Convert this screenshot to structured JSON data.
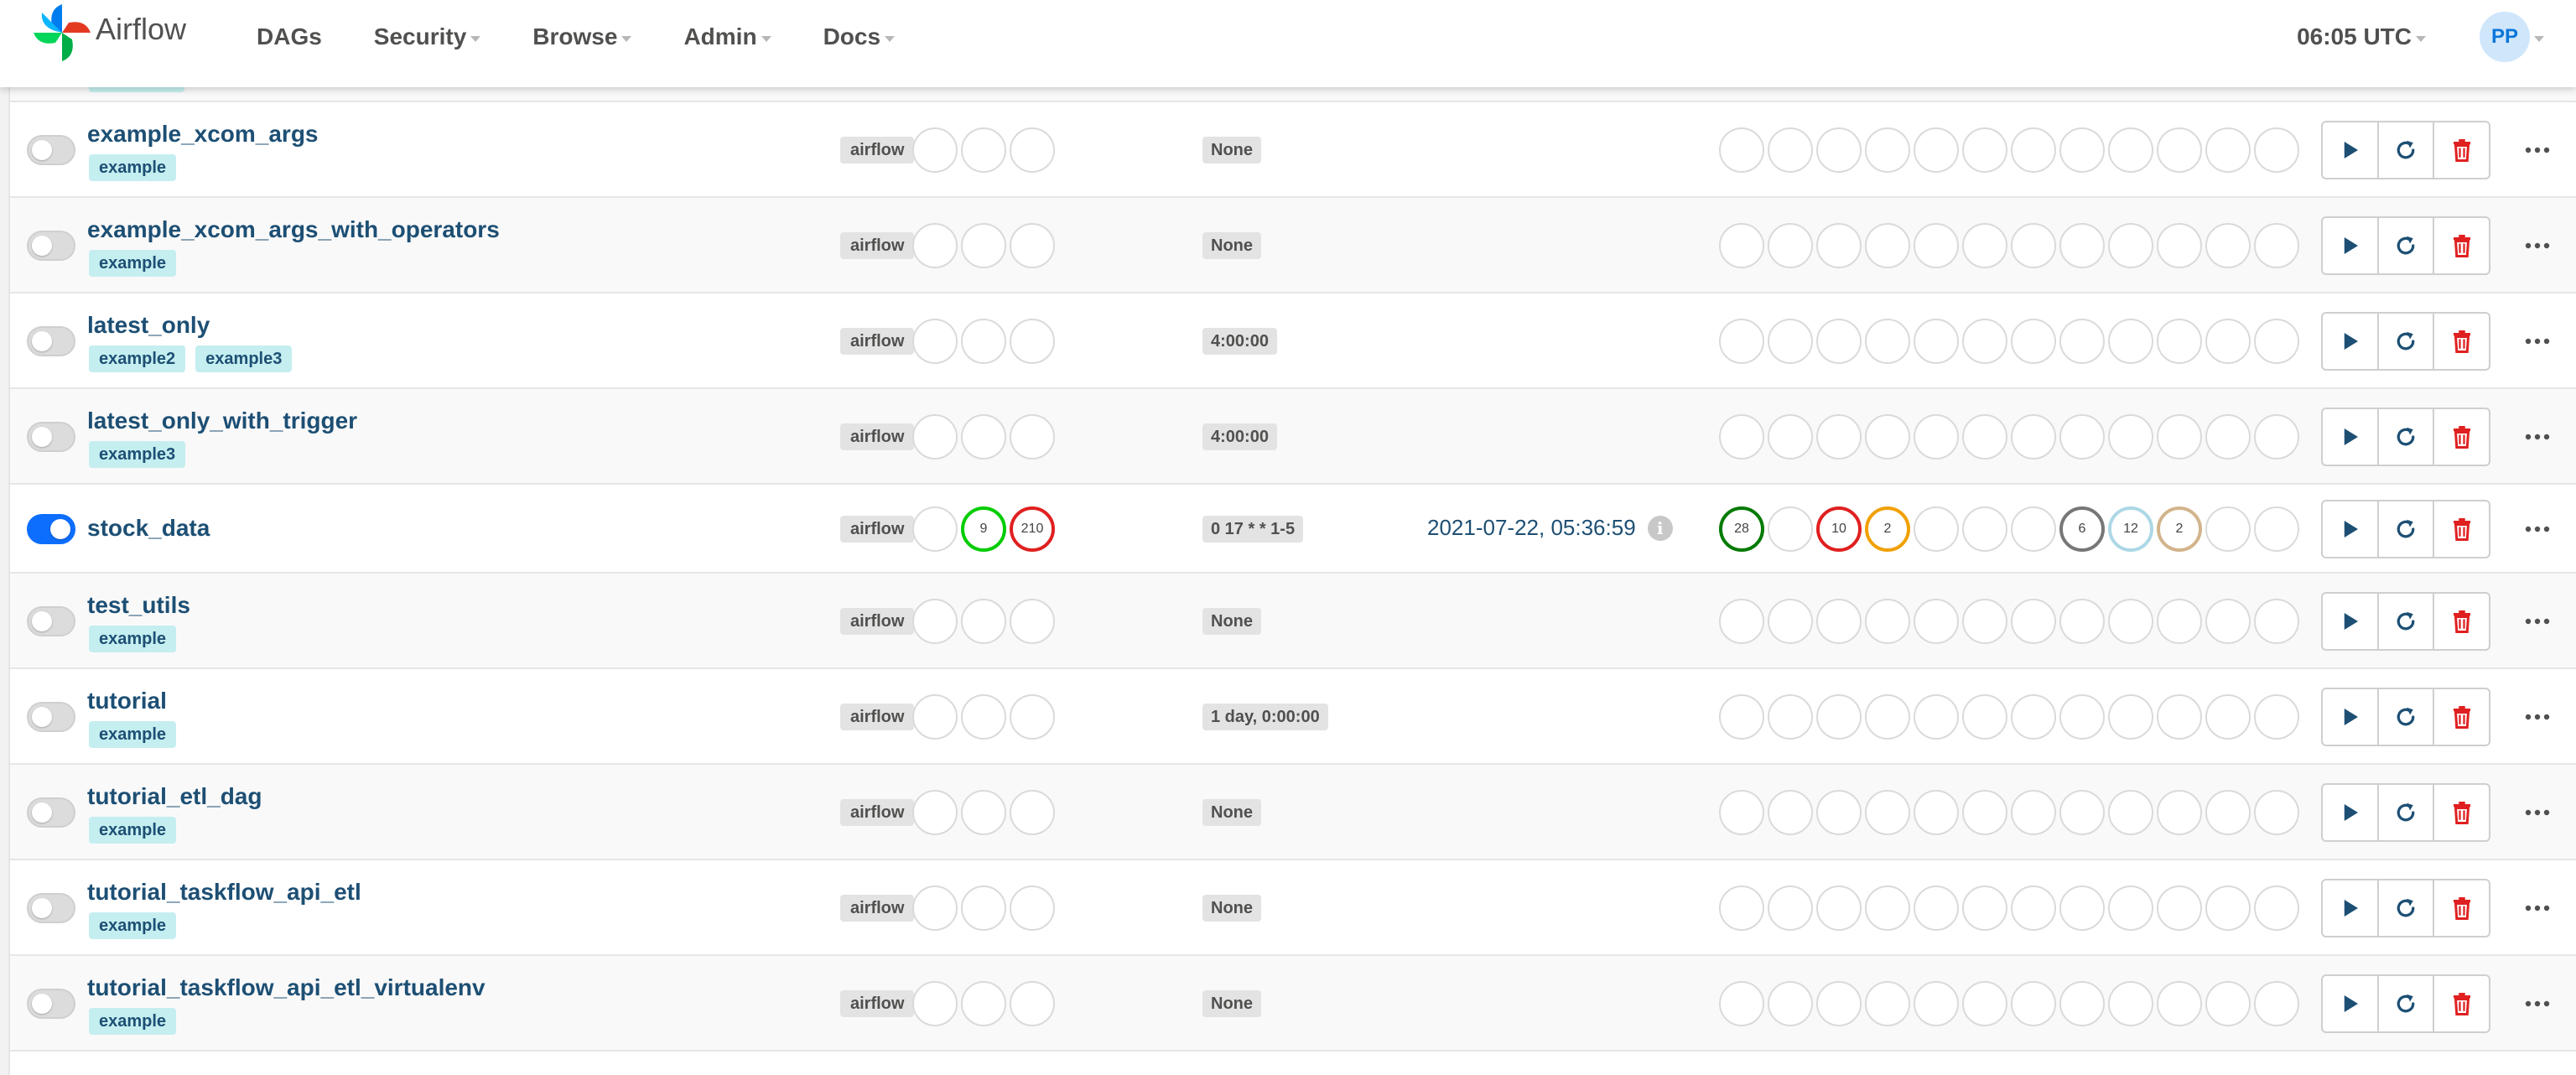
{
  "navbar": {
    "brand": "Airflow",
    "menu": [
      {
        "label": "DAGs",
        "caret": false
      },
      {
        "label": "Security",
        "caret": true
      },
      {
        "label": "Browse",
        "caret": true
      },
      {
        "label": "Admin",
        "caret": true
      },
      {
        "label": "Docs",
        "caret": true
      }
    ],
    "clock": "06:05 UTC",
    "user_initials": "PP"
  },
  "dags": [
    {
      "name": "example_xcom_args",
      "tags": [
        "example"
      ],
      "owner": "airflow",
      "active": false,
      "schedule": "None",
      "last_run": "",
      "runs": [
        "",
        "",
        ""
      ],
      "runs_colors": [
        "",
        "",
        ""
      ],
      "tasks": [
        "",
        "",
        "",
        "",
        "",
        "",
        "",
        "",
        "",
        "",
        "",
        ""
      ],
      "tasks_colors": [
        "",
        "",
        "",
        "",
        "",
        "",
        "",
        "",
        "",
        "",
        "",
        ""
      ]
    },
    {
      "name": "example_xcom_args_with_operators",
      "tags": [
        "example"
      ],
      "owner": "airflow",
      "active": false,
      "schedule": "None",
      "last_run": "",
      "runs": [
        "",
        "",
        ""
      ],
      "runs_colors": [
        "",
        "",
        ""
      ],
      "tasks": [
        "",
        "",
        "",
        "",
        "",
        "",
        "",
        "",
        "",
        "",
        "",
        ""
      ],
      "tasks_colors": [
        "",
        "",
        "",
        "",
        "",
        "",
        "",
        "",
        "",
        "",
        "",
        ""
      ]
    },
    {
      "name": "latest_only",
      "tags": [
        "example2",
        "example3"
      ],
      "owner": "airflow",
      "active": false,
      "schedule": "4:00:00",
      "last_run": "",
      "runs": [
        "",
        "",
        ""
      ],
      "runs_colors": [
        "",
        "",
        ""
      ],
      "tasks": [
        "",
        "",
        "",
        "",
        "",
        "",
        "",
        "",
        "",
        "",
        "",
        ""
      ],
      "tasks_colors": [
        "",
        "",
        "",
        "",
        "",
        "",
        "",
        "",
        "",
        "",
        "",
        ""
      ]
    },
    {
      "name": "latest_only_with_trigger",
      "tags": [
        "example3"
      ],
      "owner": "airflow",
      "active": false,
      "schedule": "4:00:00",
      "last_run": "",
      "runs": [
        "",
        "",
        ""
      ],
      "runs_colors": [
        "",
        "",
        ""
      ],
      "tasks": [
        "",
        "",
        "",
        "",
        "",
        "",
        "",
        "",
        "",
        "",
        "",
        ""
      ],
      "tasks_colors": [
        "",
        "",
        "",
        "",
        "",
        "",
        "",
        "",
        "",
        "",
        "",
        ""
      ]
    },
    {
      "name": "stock_data",
      "tags": [],
      "owner": "airflow",
      "active": true,
      "schedule": "0 17 * * 1-5",
      "last_run": "2021-07-22, 05:36:59",
      "runs": [
        "",
        "9",
        "210"
      ],
      "runs_colors": [
        "",
        "#00cc00",
        "#e02020"
      ],
      "tasks": [
        "28",
        "",
        "10",
        "2",
        "",
        "",
        "",
        "6",
        "12",
        "2",
        "",
        ""
      ],
      "tasks_colors": [
        "#007a00",
        "",
        "#e02020",
        "#f0a000",
        "",
        "",
        "",
        "#777777",
        "#add8e6",
        "#d2b48c",
        "",
        ""
      ]
    },
    {
      "name": "test_utils",
      "tags": [
        "example"
      ],
      "owner": "airflow",
      "active": false,
      "schedule": "None",
      "last_run": "",
      "runs": [
        "",
        "",
        ""
      ],
      "runs_colors": [
        "",
        "",
        ""
      ],
      "tasks": [
        "",
        "",
        "",
        "",
        "",
        "",
        "",
        "",
        "",
        "",
        "",
        ""
      ],
      "tasks_colors": [
        "",
        "",
        "",
        "",
        "",
        "",
        "",
        "",
        "",
        "",
        "",
        ""
      ]
    },
    {
      "name": "tutorial",
      "tags": [
        "example"
      ],
      "owner": "airflow",
      "active": false,
      "schedule": "1 day, 0:00:00",
      "last_run": "",
      "runs": [
        "",
        "",
        ""
      ],
      "runs_colors": [
        "",
        "",
        ""
      ],
      "tasks": [
        "",
        "",
        "",
        "",
        "",
        "",
        "",
        "",
        "",
        "",
        "",
        ""
      ],
      "tasks_colors": [
        "",
        "",
        "",
        "",
        "",
        "",
        "",
        "",
        "",
        "",
        "",
        ""
      ]
    },
    {
      "name": "tutorial_etl_dag",
      "tags": [
        "example"
      ],
      "owner": "airflow",
      "active": false,
      "schedule": "None",
      "last_run": "",
      "runs": [
        "",
        "",
        ""
      ],
      "runs_colors": [
        "",
        "",
        ""
      ],
      "tasks": [
        "",
        "",
        "",
        "",
        "",
        "",
        "",
        "",
        "",
        "",
        "",
        ""
      ],
      "tasks_colors": [
        "",
        "",
        "",
        "",
        "",
        "",
        "",
        "",
        "",
        "",
        "",
        ""
      ]
    },
    {
      "name": "tutorial_taskflow_api_etl",
      "tags": [
        "example"
      ],
      "owner": "airflow",
      "active": false,
      "schedule": "None",
      "last_run": "",
      "runs": [
        "",
        "",
        ""
      ],
      "runs_colors": [
        "",
        "",
        ""
      ],
      "tasks": [
        "",
        "",
        "",
        "",
        "",
        "",
        "",
        "",
        "",
        "",
        "",
        ""
      ],
      "tasks_colors": [
        "",
        "",
        "",
        "",
        "",
        "",
        "",
        "",
        "",
        "",
        "",
        ""
      ]
    },
    {
      "name": "tutorial_taskflow_api_etl_virtualenv",
      "tags": [
        "example"
      ],
      "owner": "airflow",
      "active": false,
      "schedule": "None",
      "last_run": "",
      "runs": [
        "",
        "",
        ""
      ],
      "runs_colors": [
        "",
        "",
        ""
      ],
      "tasks": [
        "",
        "",
        "",
        "",
        "",
        "",
        "",
        "",
        "",
        "",
        "",
        ""
      ],
      "tasks_colors": [
        "",
        "",
        "",
        "",
        "",
        "",
        "",
        "",
        "",
        "",
        "",
        ""
      ]
    }
  ],
  "icons": {
    "trigger": "play-icon",
    "refresh": "refresh-icon",
    "delete": "trash-icon",
    "more": "ellipsis-icon"
  },
  "colors": {
    "link": "#1d4f74",
    "tag_bg": "#c5eef0",
    "toggle_on": "#0d6efd",
    "delete": "#e02020"
  }
}
